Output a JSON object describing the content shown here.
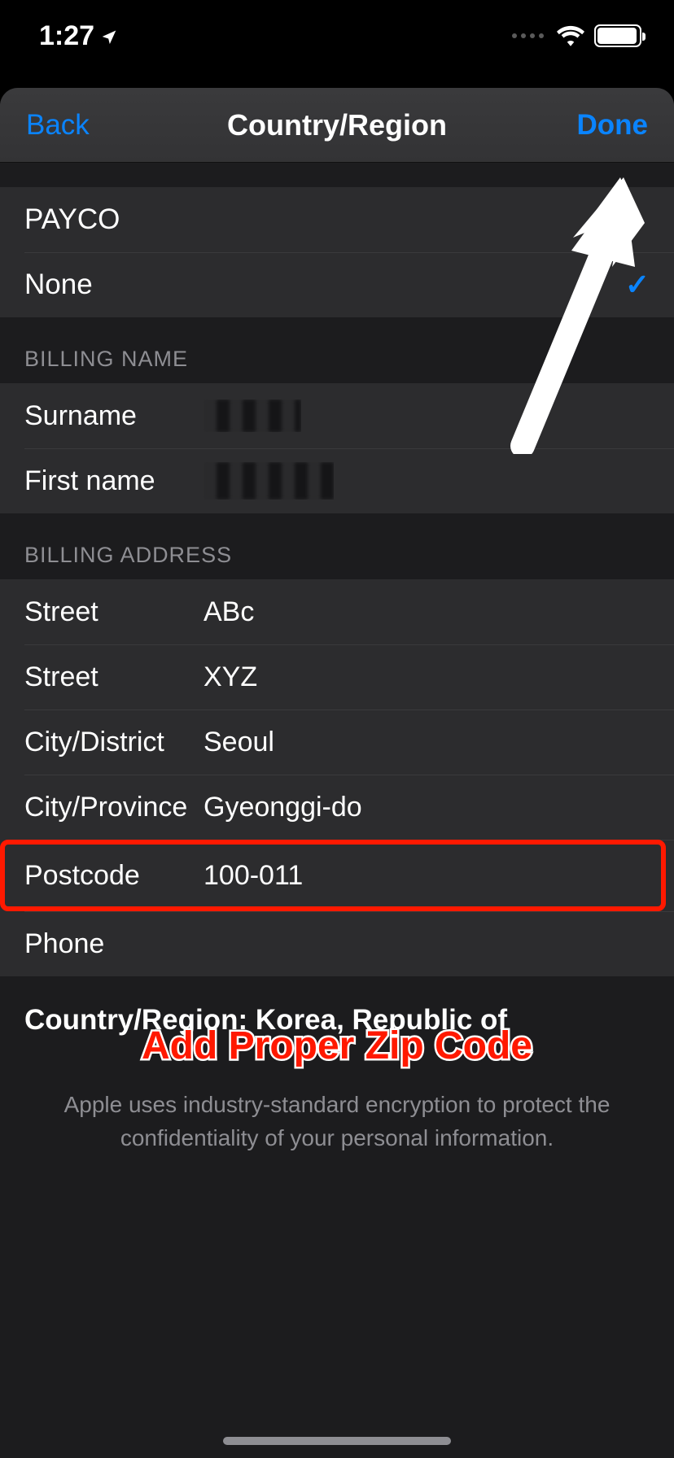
{
  "status": {
    "time": "1:27",
    "location_active": true
  },
  "nav": {
    "back_label": "Back",
    "title": "Country/Region",
    "done_label": "Done"
  },
  "payment_options": [
    {
      "label": "PAYCO",
      "selected": false
    },
    {
      "label": "None",
      "selected": true
    }
  ],
  "sections": {
    "billing_name_header": "BILLING NAME",
    "billing_address_header": "BILLING ADDRESS"
  },
  "billing_name": {
    "surname_label": "Surname",
    "surname_value": "",
    "first_name_label": "First name",
    "first_name_value": ""
  },
  "billing_address": {
    "street1_label": "Street",
    "street1_value": "ABc",
    "street2_label": "Street",
    "street2_value": "XYZ",
    "city_district_label": "City/District",
    "city_district_value": "Seoul",
    "city_province_label": "City/Province",
    "city_province_value": "Gyeonggi-do",
    "postcode_label": "Postcode",
    "postcode_value": "100-011",
    "phone_label": "Phone",
    "phone_value": ""
  },
  "country_line": "Country/Region: Korea, Republic of",
  "footer": "Apple uses industry-standard encryption to protect the\nconfidentiality of your personal information.",
  "annotation": "Add Proper Zip Code"
}
